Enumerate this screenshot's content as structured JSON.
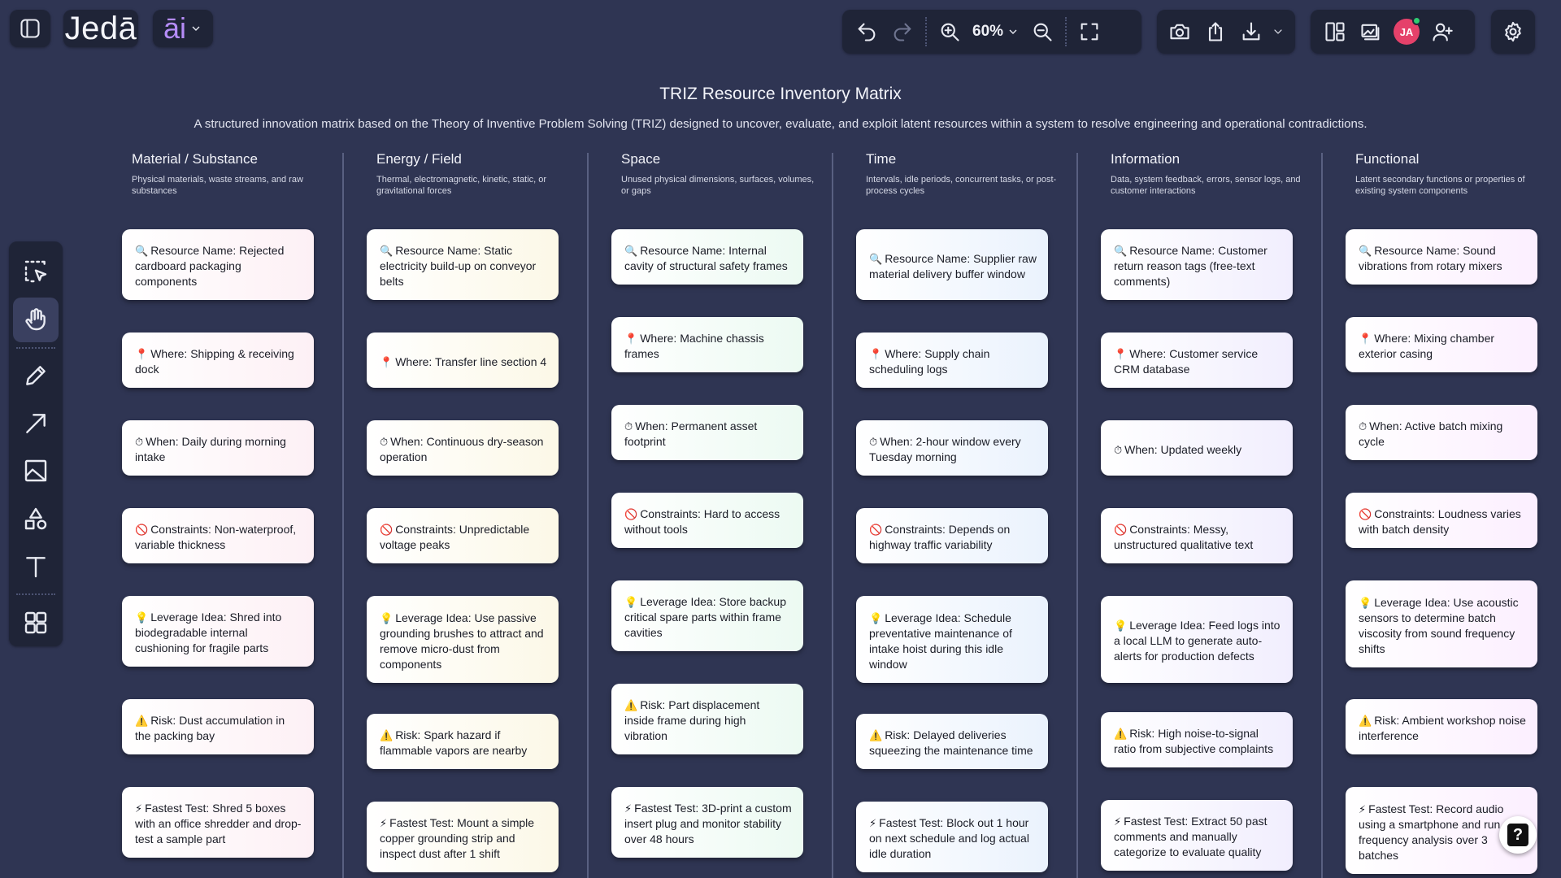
{
  "brand": {
    "name": "Jedā",
    "ai_label": "āi"
  },
  "toolbar": {
    "zoom": "60%",
    "avatar_initials": "JA"
  },
  "board": {
    "title": "TRIZ Resource Inventory Matrix",
    "subtitle": "A structured innovation matrix based on the Theory of Inventive Problem Solving (TRIZ) designed to uncover, evaluate, and exploit latent resources within a system to resolve engineering and operational contradictions."
  },
  "colors": {
    "background": "#2f3553",
    "panel": "#1f2437",
    "avatar": "#e5416a",
    "online": "#2ecc71",
    "ai_accent": "#b58cf7"
  },
  "columns": [
    {
      "title": "Material / Substance",
      "description": "Physical materials, waste streams, and raw substances",
      "cards": [
        {
          "icon": "🔍",
          "text": "Resource Name: Rejected cardboard packaging components"
        },
        {
          "icon": "📍",
          "text": "Where: Shipping & receiving dock"
        },
        {
          "icon": "⏱",
          "text": "When: Daily during morning intake"
        },
        {
          "icon": "🚫",
          "text": "Constraints: Non-waterproof, variable thickness"
        },
        {
          "icon": "💡",
          "text": "Leverage Idea: Shred into biodegradable internal cushioning for fragile parts"
        },
        {
          "icon": "⚠️",
          "text": "Risk: Dust accumulation in the packing bay"
        },
        {
          "icon": "⚡",
          "text": "Fastest Test: Shred 5 boxes with an office shredder and drop-test a sample part"
        }
      ]
    },
    {
      "title": "Energy / Field",
      "description": "Thermal, electromagnetic, kinetic, static, or gravitational forces",
      "cards": [
        {
          "icon": "🔍",
          "text": "Resource Name: Static electricity build-up on conveyor belts"
        },
        {
          "icon": "📍",
          "text": "Where: Transfer line section 4"
        },
        {
          "icon": "⏱",
          "text": "When: Continuous dry-season operation"
        },
        {
          "icon": "🚫",
          "text": "Constraints: Unpredictable voltage peaks"
        },
        {
          "icon": "💡",
          "text": "Leverage Idea: Use passive grounding brushes to attract and remove micro-dust from components"
        },
        {
          "icon": "⚠️",
          "text": "Risk: Spark hazard if flammable vapors are nearby"
        },
        {
          "icon": "⚡",
          "text": "Fastest Test: Mount a simple copper grounding strip and inspect dust after 1 shift"
        }
      ]
    },
    {
      "title": "Space",
      "description": "Unused physical dimensions, surfaces, volumes, or gaps",
      "cards": [
        {
          "icon": "🔍",
          "text": "Resource Name: Internal cavity of structural safety frames"
        },
        {
          "icon": "📍",
          "text": "Where: Machine chassis frames"
        },
        {
          "icon": "⏱",
          "text": "When: Permanent asset footprint"
        },
        {
          "icon": "🚫",
          "text": "Constraints: Hard to access without tools"
        },
        {
          "icon": "💡",
          "text": "Leverage Idea: Store backup critical spare parts within frame cavities"
        },
        {
          "icon": "⚠️",
          "text": "Risk: Part displacement inside frame during high vibration"
        },
        {
          "icon": "⚡",
          "text": "Fastest Test: 3D-print a custom insert plug and monitor stability over 48 hours"
        }
      ]
    },
    {
      "title": "Time",
      "description": "Intervals, idle periods, concurrent tasks, or post-process cycles",
      "cards": [
        {
          "icon": "🔍",
          "text": "Resource Name: Supplier raw material delivery buffer window"
        },
        {
          "icon": "📍",
          "text": "Where: Supply chain scheduling logs"
        },
        {
          "icon": "⏱",
          "text": "When: 2-hour window every Tuesday morning"
        },
        {
          "icon": "🚫",
          "text": "Constraints: Depends on highway traffic variability"
        },
        {
          "icon": "💡",
          "text": "Leverage Idea: Schedule preventative maintenance of intake hoist during this idle window"
        },
        {
          "icon": "⚠️",
          "text": "Risk: Delayed deliveries squeezing the maintenance time"
        },
        {
          "icon": "⚡",
          "text": "Fastest Test: Block out 1 hour on next schedule and log actual idle duration"
        }
      ]
    },
    {
      "title": "Information",
      "description": "Data, system feedback, errors, sensor logs, and customer interactions",
      "cards": [
        {
          "icon": "🔍",
          "text": "Resource Name: Customer return reason tags (free-text comments)"
        },
        {
          "icon": "📍",
          "text": "Where: Customer service CRM database"
        },
        {
          "icon": "⏱",
          "text": "When: Updated weekly"
        },
        {
          "icon": "🚫",
          "text": "Constraints: Messy, unstructured qualitative text"
        },
        {
          "icon": "💡",
          "text": "Leverage Idea: Feed logs into a local LLM to generate auto-alerts for production defects"
        },
        {
          "icon": "⚠️",
          "text": "Risk: High noise-to-signal ratio from subjective complaints"
        },
        {
          "icon": "⚡",
          "text": "Fastest Test: Extract 50 past comments and manually categorize to evaluate quality"
        }
      ]
    },
    {
      "title": "Functional",
      "description": "Latent secondary functions or properties of existing system components",
      "cards": [
        {
          "icon": "🔍",
          "text": "Resource Name: Sound vibrations from rotary mixers"
        },
        {
          "icon": "📍",
          "text": "Where: Mixing chamber exterior casing"
        },
        {
          "icon": "⏱",
          "text": "When: Active batch mixing cycle"
        },
        {
          "icon": "🚫",
          "text": "Constraints: Loudness varies with batch density"
        },
        {
          "icon": "💡",
          "text": "Leverage Idea: Use acoustic sensors to determine batch viscosity from sound frequency shifts"
        },
        {
          "icon": "⚠️",
          "text": "Risk: Ambient workshop noise interference"
        },
        {
          "icon": "⚡",
          "text": "Fastest Test: Record audio using a smartphone and run frequency analysis over 3 batches"
        }
      ]
    }
  ]
}
